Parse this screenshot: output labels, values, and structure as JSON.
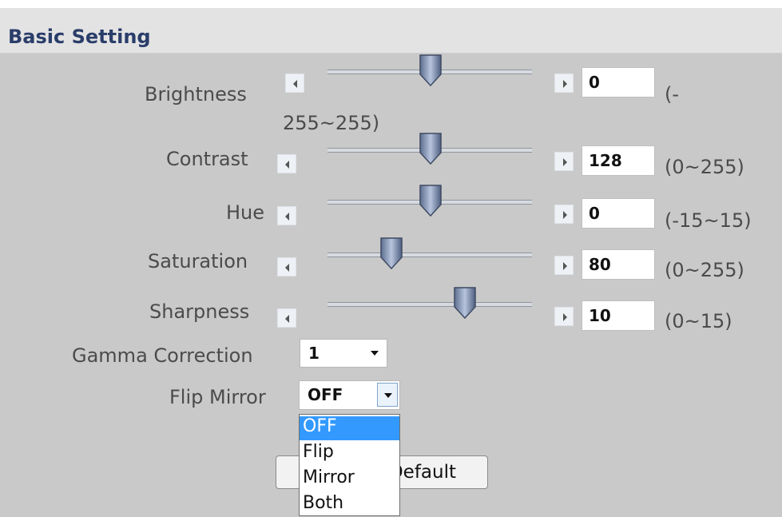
{
  "header": {
    "title": "Basic Setting"
  },
  "sliders": [
    {
      "label": "Brightness",
      "value": "0",
      "range_line1": "(-",
      "range_line2": "255~255)",
      "position_fraction": 0.5
    },
    {
      "label": "Contrast",
      "value": "128",
      "range": "(0~255)",
      "position_fraction": 0.5
    },
    {
      "label": "Hue",
      "value": "0",
      "range": "(-15~15)",
      "position_fraction": 0.5
    },
    {
      "label": "Saturation",
      "value": "80",
      "range": "(0~255)",
      "position_fraction": 0.31
    },
    {
      "label": "Sharpness",
      "value": "10",
      "range": "(0~15)",
      "position_fraction": 0.67
    }
  ],
  "gamma": {
    "label": "Gamma Correction",
    "value": "1"
  },
  "flip_mirror": {
    "label": "Flip Mirror",
    "value": "OFF",
    "options": [
      "OFF",
      "Flip",
      "Mirror",
      "Both"
    ],
    "highlighted": "OFF"
  },
  "reset_button": {
    "label": "Reset to Default"
  },
  "colors": {
    "panel": "#c9c9c9",
    "header": "#e3e3e3",
    "title": "#2a3d6a",
    "highlight": "#3399ff"
  }
}
